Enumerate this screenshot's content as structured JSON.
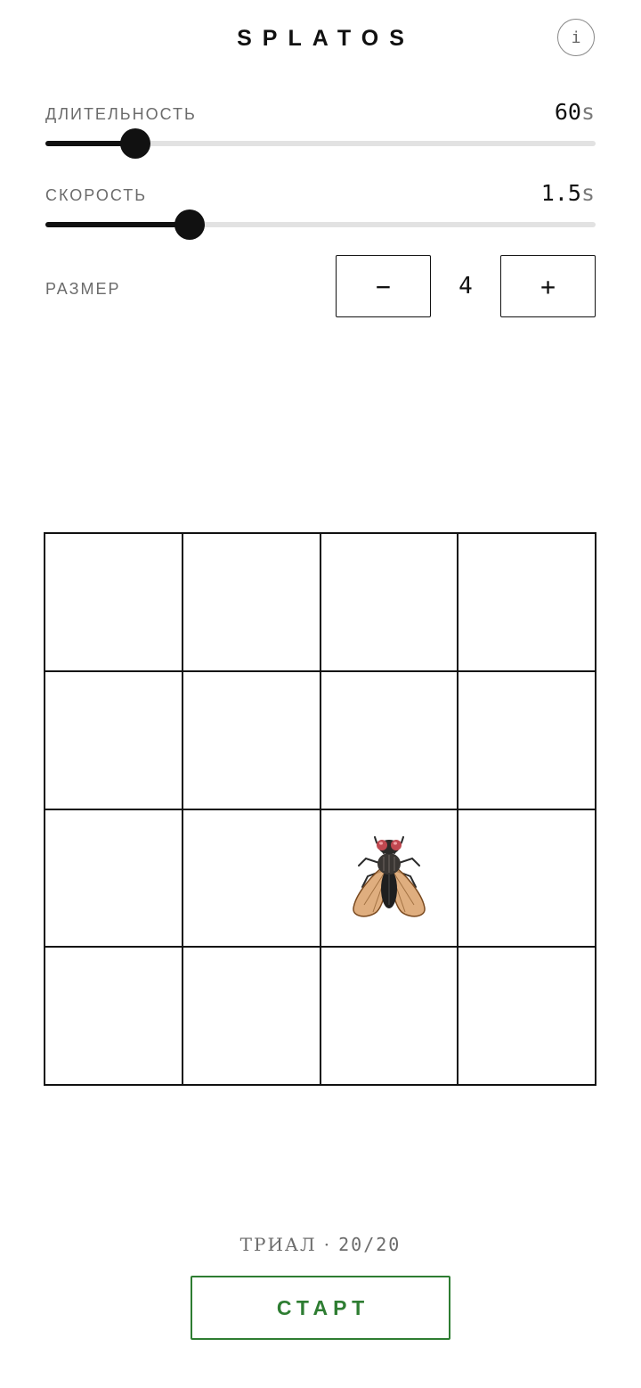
{
  "app": {
    "title": "SPLATOS",
    "info_label": "i"
  },
  "settings": {
    "duration": {
      "label": "ДЛИТЕЛЬНОСТЬ",
      "value": "60",
      "unit": "s",
      "slider_fraction": 0.163
    },
    "speed": {
      "label": "СКОРОСТЬ",
      "value": "1.5",
      "unit": "s",
      "slider_fraction": 0.262
    },
    "size": {
      "label": "РАЗМЕР",
      "value": "4",
      "decrement_label": "−",
      "increment_label": "+"
    }
  },
  "board": {
    "rows": 4,
    "cols": 4,
    "target_row": 3,
    "target_col": 3,
    "target_icon": "fly-icon"
  },
  "footer": {
    "trial_label": "ТРИАЛ",
    "separator": "·",
    "trial_count": "20/20",
    "start_label": "СТАРТ"
  },
  "colors": {
    "text": "#111111",
    "muted": "#6b6b6b",
    "track": "#e2e2e2",
    "accent_green": "#2e7d32"
  }
}
